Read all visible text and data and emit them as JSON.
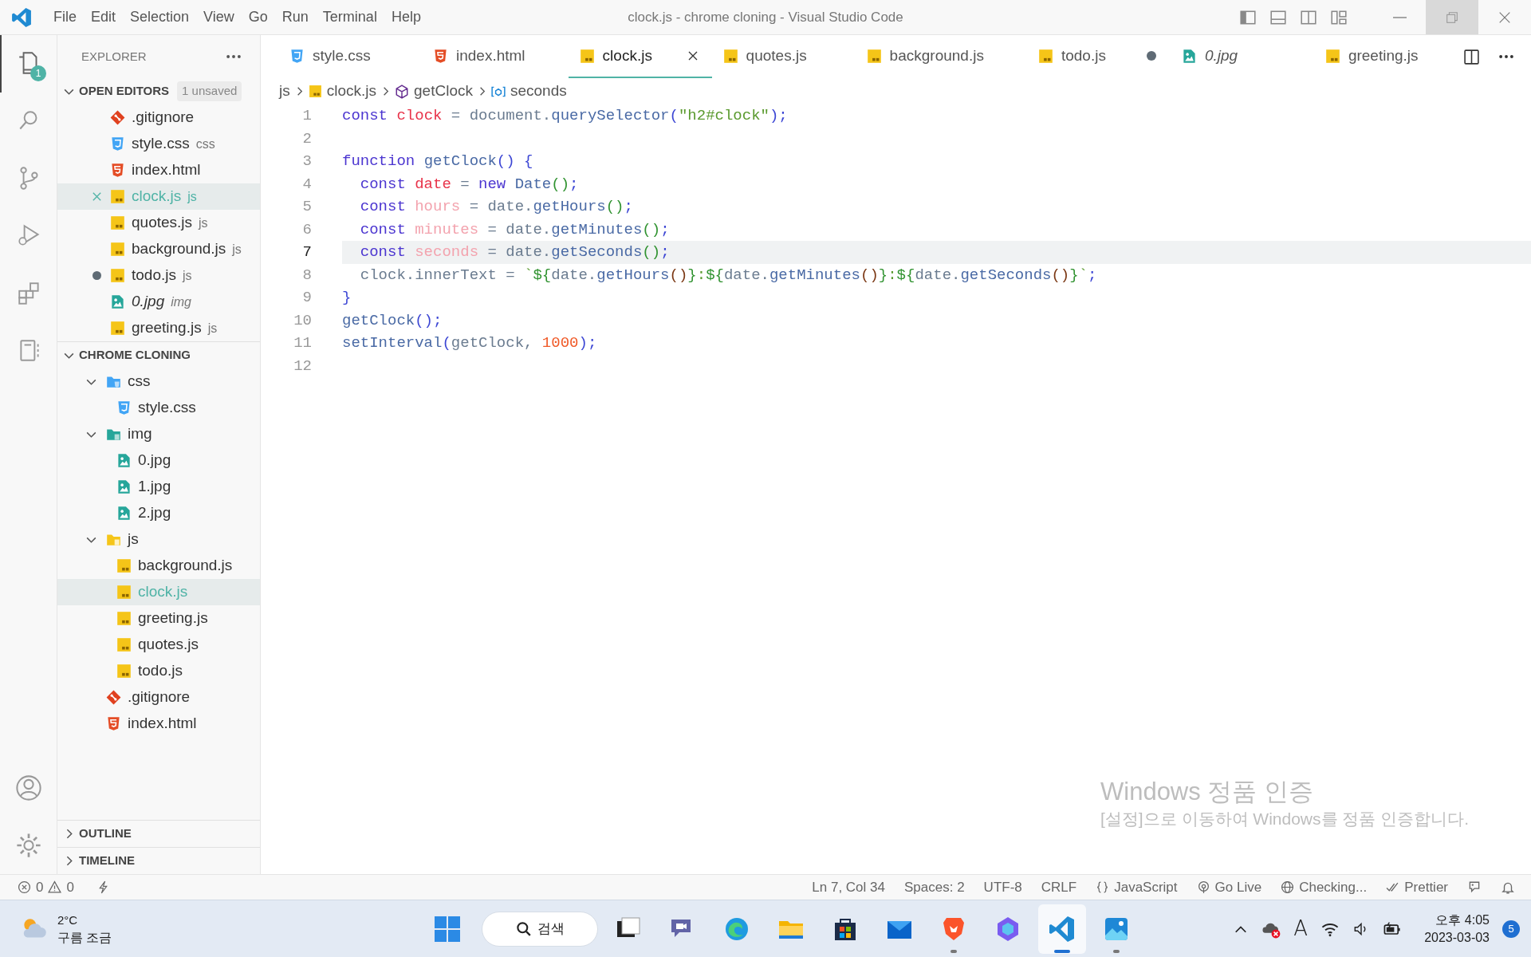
{
  "title_bar": {
    "menu": [
      "File",
      "Edit",
      "Selection",
      "View",
      "Go",
      "Run",
      "Terminal",
      "Help"
    ],
    "title": "clock.js - chrome cloning - Visual Studio Code"
  },
  "activity_bar": {
    "items": [
      {
        "kind": "files",
        "selected": true,
        "badge": "1"
      },
      {
        "kind": "search",
        "selected": false
      },
      {
        "kind": "source-control",
        "selected": false
      },
      {
        "kind": "run-debug",
        "selected": false
      },
      {
        "kind": "extensions",
        "selected": false
      },
      {
        "kind": "notebook",
        "selected": false
      }
    ],
    "bottom": [
      {
        "kind": "account"
      },
      {
        "kind": "settings"
      }
    ]
  },
  "sidebar": {
    "header": "EXPLORER",
    "open_editors": {
      "title": "OPEN EDITORS",
      "badge": "1 unsaved",
      "expanded": true,
      "items": [
        {
          "name": ".gitignore",
          "kind": "git",
          "dirty": false,
          "selected": false,
          "preview": false
        },
        {
          "name": "style.css",
          "hint": "css",
          "kind": "css",
          "dirty": false,
          "selected": false,
          "preview": false
        },
        {
          "name": "index.html",
          "kind": "html",
          "dirty": false,
          "selected": false,
          "preview": false
        },
        {
          "name": "clock.js",
          "hint": "js",
          "kind": "js",
          "dirty": false,
          "selected": true,
          "preview": false
        },
        {
          "name": "quotes.js",
          "hint": "js",
          "kind": "js",
          "dirty": false,
          "selected": false,
          "preview": false
        },
        {
          "name": "background.js",
          "hint": "js",
          "kind": "js",
          "dirty": false,
          "selected": false,
          "preview": false
        },
        {
          "name": "todo.js",
          "hint": "js",
          "kind": "js",
          "dirty": true,
          "selected": false,
          "preview": false
        },
        {
          "name": "0.jpg",
          "hint": "img",
          "kind": "image",
          "dirty": false,
          "selected": false,
          "preview": true
        },
        {
          "name": "greeting.js",
          "hint": "js",
          "kind": "js",
          "dirty": false,
          "selected": false,
          "preview": false
        }
      ]
    },
    "folder": {
      "title": "CHROME CLONING",
      "expanded": true,
      "children": [
        {
          "name": "css",
          "kind": "folder-css",
          "expanded": true,
          "selected": false,
          "children": [
            {
              "name": "style.css",
              "kind": "css",
              "selected": false
            }
          ]
        },
        {
          "name": "img",
          "kind": "folder-img",
          "expanded": true,
          "selected": false,
          "children": [
            {
              "name": "0.jpg",
              "kind": "image",
              "selected": false
            },
            {
              "name": "1.jpg",
              "kind": "image",
              "selected": false
            },
            {
              "name": "2.jpg",
              "kind": "image",
              "selected": false
            }
          ]
        },
        {
          "name": "js",
          "kind": "folder-js",
          "expanded": true,
          "selected": false,
          "children": [
            {
              "name": "background.js",
              "kind": "js",
              "selected": false
            },
            {
              "name": "clock.js",
              "kind": "js",
              "selected": true
            },
            {
              "name": "greeting.js",
              "kind": "js",
              "selected": false
            },
            {
              "name": "quotes.js",
              "kind": "js",
              "selected": false
            },
            {
              "name": "todo.js",
              "kind": "js",
              "selected": false
            }
          ]
        },
        {
          "name": ".gitignore",
          "kind": "git",
          "selected": false
        },
        {
          "name": "index.html",
          "kind": "html",
          "selected": false
        }
      ]
    },
    "sections": [
      {
        "title": "OUTLINE",
        "expanded": false
      },
      {
        "title": "TIMELINE",
        "expanded": false
      }
    ]
  },
  "tabs": [
    {
      "label": "style.css",
      "kind": "css",
      "selected": false,
      "dirty": false,
      "preview": false
    },
    {
      "label": "index.html",
      "kind": "html",
      "selected": false,
      "dirty": false,
      "preview": false
    },
    {
      "label": "clock.js",
      "kind": "js",
      "selected": true,
      "dirty": false,
      "preview": false
    },
    {
      "label": "quotes.js",
      "kind": "js",
      "selected": false,
      "dirty": false,
      "preview": false
    },
    {
      "label": "background.js",
      "kind": "js",
      "selected": false,
      "dirty": false,
      "preview": false
    },
    {
      "label": "todo.js",
      "kind": "js",
      "selected": false,
      "dirty": true,
      "preview": false
    },
    {
      "label": "0.jpg",
      "kind": "image",
      "selected": false,
      "dirty": false,
      "preview": true
    },
    {
      "label": "greeting.js",
      "kind": "js",
      "selected": false,
      "dirty": false,
      "preview": false
    }
  ],
  "breadcrumb": [
    {
      "text": "js",
      "kind": "folder"
    },
    {
      "text": "clock.js",
      "kind": "js"
    },
    {
      "text": "getClock",
      "kind": "function"
    },
    {
      "text": "seconds",
      "kind": "variable"
    }
  ],
  "code": [
    {
      "number": "1",
      "current": false,
      "tokens": [
        {
          "text": "const ",
          "kind": "kw"
        },
        {
          "text": "clock",
          "kind": "var"
        },
        {
          "text": " = ",
          "kind": "op"
        },
        {
          "text": "document.",
          "kind": "id"
        },
        {
          "text": "querySelector",
          "kind": "fn"
        },
        {
          "text": "(",
          "kind": "b1"
        },
        {
          "text": "\"h2#clock\"",
          "kind": "str"
        },
        {
          "text": ")",
          "kind": "b1"
        },
        {
          "text": ";",
          "kind": "p"
        }
      ]
    },
    {
      "number": "2",
      "current": false
    },
    {
      "number": "3",
      "current": false,
      "tokens": [
        {
          "text": "function ",
          "kind": "kw"
        },
        {
          "text": "getClock",
          "kind": "fn"
        },
        {
          "text": "()",
          "kind": "b1"
        },
        {
          "text": " {",
          "kind": "b1"
        }
      ]
    },
    {
      "number": "4",
      "current": false,
      "tokens": [
        {
          "text": "  const ",
          "kind": "kw"
        },
        {
          "text": "date",
          "kind": "var"
        },
        {
          "text": " = ",
          "kind": "op"
        },
        {
          "text": "new ",
          "kind": "kw"
        },
        {
          "text": "Date",
          "kind": "fn"
        },
        {
          "text": "()",
          "kind": "b2"
        },
        {
          "text": ";",
          "kind": "p"
        }
      ]
    },
    {
      "number": "5",
      "current": false,
      "tokens": [
        {
          "text": "  const ",
          "kind": "kw"
        },
        {
          "text": "hours",
          "kind": "unused"
        },
        {
          "text": " = ",
          "kind": "op"
        },
        {
          "text": "date.",
          "kind": "id"
        },
        {
          "text": "getHours",
          "kind": "fn"
        },
        {
          "text": "()",
          "kind": "b2"
        },
        {
          "text": ";",
          "kind": "p"
        }
      ]
    },
    {
      "number": "6",
      "current": false,
      "tokens": [
        {
          "text": "  const ",
          "kind": "kw"
        },
        {
          "text": "minutes",
          "kind": "unused"
        },
        {
          "text": " = ",
          "kind": "op"
        },
        {
          "text": "date.",
          "kind": "id"
        },
        {
          "text": "getMinutes",
          "kind": "fn"
        },
        {
          "text": "()",
          "kind": "b2"
        },
        {
          "text": ";",
          "kind": "p"
        }
      ]
    },
    {
      "number": "7",
      "current": true,
      "tokens": [
        {
          "text": "  const ",
          "kind": "kw"
        },
        {
          "text": "seconds",
          "kind": "unused"
        },
        {
          "text": " = ",
          "kind": "op"
        },
        {
          "text": "date.",
          "kind": "id"
        },
        {
          "text": "getSeconds",
          "kind": "fn"
        },
        {
          "text": "()",
          "kind": "b2"
        },
        {
          "text": ";",
          "kind": "p"
        }
      ]
    },
    {
      "number": "8",
      "current": false,
      "tokens": [
        {
          "text": "  clock.innerText = ",
          "kind": "id"
        },
        {
          "text": "`",
          "kind": "str"
        },
        {
          "text": "${",
          "kind": "b2"
        },
        {
          "text": "date.",
          "kind": "id"
        },
        {
          "text": "getHours",
          "kind": "fn"
        },
        {
          "text": "()",
          "kind": "b3"
        },
        {
          "text": "}",
          "kind": "b2"
        },
        {
          "text": ":",
          "kind": "str"
        },
        {
          "text": "${",
          "kind": "b2"
        },
        {
          "text": "date.",
          "kind": "id"
        },
        {
          "text": "getMinutes",
          "kind": "fn"
        },
        {
          "text": "()",
          "kind": "b3"
        },
        {
          "text": "}",
          "kind": "b2"
        },
        {
          "text": ":",
          "kind": "str"
        },
        {
          "text": "${",
          "kind": "b2"
        },
        {
          "text": "date.",
          "kind": "id"
        },
        {
          "text": "getSeconds",
          "kind": "fn"
        },
        {
          "text": "()",
          "kind": "b3"
        },
        {
          "text": "}",
          "kind": "b2"
        },
        {
          "text": "`",
          "kind": "str"
        },
        {
          "text": ";",
          "kind": "p"
        }
      ]
    },
    {
      "number": "9",
      "current": false,
      "tokens": [
        {
          "text": "}",
          "kind": "b1"
        }
      ]
    },
    {
      "number": "10",
      "current": false,
      "tokens": [
        {
          "text": "getClock",
          "kind": "fn"
        },
        {
          "text": "()",
          "kind": "b1"
        },
        {
          "text": ";",
          "kind": "p"
        }
      ]
    },
    {
      "number": "11",
      "current": false,
      "tokens": [
        {
          "text": "setInterval",
          "kind": "fn"
        },
        {
          "text": "(",
          "kind": "b1"
        },
        {
          "text": "getClock, ",
          "kind": "id"
        },
        {
          "text": "1000",
          "kind": "num"
        },
        {
          "text": ")",
          "kind": "b1"
        },
        {
          "text": ";",
          "kind": "p"
        }
      ]
    },
    {
      "number": "12",
      "current": false
    }
  ],
  "activation_notice": {
    "title": "Windows 정품 인증",
    "message": "[설정]으로 이동하여 Windows를 정품 인증합니다."
  },
  "status_bar": {
    "errors": "0",
    "warnings": "0",
    "items": [
      {
        "label": "Ln 7, Col 34"
      },
      {
        "label": "Spaces: 2"
      },
      {
        "label": "UTF-8"
      },
      {
        "label": "CRLF"
      },
      {
        "label": "JavaScript",
        "kind": "language"
      },
      {
        "label": "Go Live",
        "kind": "live"
      },
      {
        "label": "Checking...",
        "kind": "web"
      },
      {
        "label": "Prettier",
        "kind": "formatter"
      }
    ]
  },
  "taskbar": {
    "weather": {
      "temperature": "2°C",
      "condition": "구름 조금"
    },
    "search": "검색",
    "apps": [
      {
        "kind": "task-view",
        "running": false,
        "selected": false
      },
      {
        "kind": "chat",
        "running": false,
        "selected": false
      },
      {
        "kind": "edge",
        "running": false,
        "selected": false
      },
      {
        "kind": "folder",
        "running": false,
        "selected": false
      },
      {
        "kind": "store",
        "running": false,
        "selected": false
      },
      {
        "kind": "mail",
        "running": false,
        "selected": false
      },
      {
        "kind": "brave",
        "running": true,
        "selected": false
      },
      {
        "kind": "copilot",
        "running": false,
        "selected": false
      },
      {
        "kind": "vscode",
        "running": true,
        "selected": true
      },
      {
        "kind": "photos",
        "running": true,
        "selected": false
      }
    ],
    "ime": "A",
    "time": "오후 4:05",
    "date": "2023-03-03",
    "notifications": "5"
  }
}
